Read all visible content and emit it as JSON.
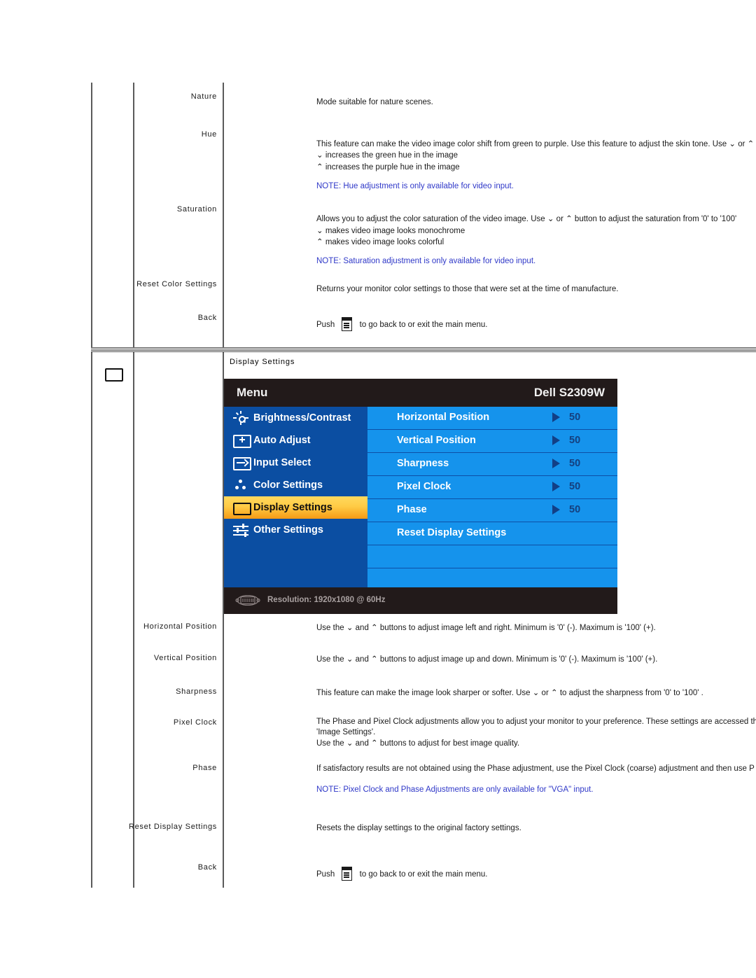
{
  "document": {
    "sections": [
      {
        "id": "color-settings-continued",
        "rows": [
          {
            "label": "Nature",
            "lines": [
              {
                "text": "Mode suitable for nature scenes."
              }
            ]
          },
          {
            "label": "Hue",
            "lines": [
              {
                "text": "This feature can make the video image color shift from green to purple. Use this feature to adjust the skin tone. Use ⌄ or ⌃"
              },
              {
                "text": "⌄ increases the green hue in the image"
              },
              {
                "text": "⌃ increases the purple hue in the image"
              },
              {
                "text": "NOTE: Hue adjustment is only available for video input.",
                "note": true
              }
            ]
          },
          {
            "label": "Saturation",
            "lines": [
              {
                "text": "Allows you to adjust the color saturation of the video image. Use ⌄ or ⌃ button to adjust the saturation from '0' to '100'"
              },
              {
                "text": "⌄ makes video image looks monochrome"
              },
              {
                "text": "⌃ makes video image looks colorful"
              },
              {
                "text": "NOTE: Saturation adjustment is only available for video input.",
                "note": true
              }
            ]
          },
          {
            "label": "Reset Color Settings",
            "lines": [
              {
                "text": "Returns your monitor color settings to those that were set at the time of manufacture."
              }
            ]
          },
          {
            "label": "Back",
            "lines": [
              {
                "text": "Push",
                "suffix": "to go back to or exit the main menu.",
                "button_icon": "menu-button-icon"
              }
            ]
          }
        ]
      },
      {
        "id": "display-settings",
        "icon": "rectangle-icon",
        "title": "Display Settings",
        "rows": [
          {
            "label": "Horizontal Position",
            "lines": [
              {
                "text": "Use the ⌄ and ⌃ buttons to adjust image left and right. Minimum is '0' (-). Maximum is '100' (+)."
              }
            ]
          },
          {
            "label": "Vertical Position",
            "lines": [
              {
                "text": "Use the ⌄ and ⌃ buttons to adjust image up and down. Minimum is '0' (-). Maximum is '100' (+)."
              }
            ]
          },
          {
            "label": "Sharpness",
            "lines": [
              {
                "text": "This feature can make the image look sharper or softer. Use ⌄ or ⌃ to adjust the sharpness from '0' to '100' ."
              }
            ]
          },
          {
            "label": "Pixel Clock",
            "lines": [
              {
                "text": "The Phase and Pixel Clock adjustments allow you to adjust your monitor to your preference. These settings are accessed th"
              },
              {
                "text": "'Image Settings'."
              },
              {
                "text": "Use the ⌄ and ⌃ buttons to adjust for best image quality."
              }
            ]
          },
          {
            "label": "Phase",
            "lines": [
              {
                "text": "If satisfactory results are not obtained using the Phase adjustment, use the Pixel Clock (coarse) adjustment and then use P"
              },
              {
                "text": "NOTE: Pixel Clock and Phase Adjustments are only available for \"VGA\" input.",
                "note": true
              }
            ]
          },
          {
            "label": "Reset Display Settings",
            "lines": [
              {
                "text": "Resets the display settings to the original factory settings."
              }
            ]
          },
          {
            "label": "Back",
            "lines": [
              {
                "text": "Push",
                "suffix": "to go back to or exit the main menu.",
                "button_icon": "menu-button-icon"
              }
            ]
          }
        ]
      }
    ]
  },
  "osd": {
    "title": "Menu",
    "model": "Dell S2309W",
    "left_menu": [
      {
        "label": "Brightness/Contrast",
        "icon": "brightness-icon",
        "selected": false
      },
      {
        "label": "Auto Adjust",
        "icon": "auto-adjust-icon",
        "selected": false
      },
      {
        "label": "Input Select",
        "icon": "input-select-icon",
        "selected": false
      },
      {
        "label": "Color Settings",
        "icon": "color-settings-icon",
        "selected": false
      },
      {
        "label": "Display Settings",
        "icon": "display-settings-icon",
        "selected": true
      },
      {
        "label": "Other Settings",
        "icon": "other-settings-icon",
        "selected": false
      }
    ],
    "right_items": [
      {
        "label": "Horizontal Position",
        "value": "50",
        "arrow": true
      },
      {
        "label": "Vertical Position",
        "value": "50",
        "arrow": true
      },
      {
        "label": "Sharpness",
        "value": "50",
        "arrow": true
      },
      {
        "label": "Pixel Clock",
        "value": "50",
        "arrow": true
      },
      {
        "label": "Phase",
        "value": "50",
        "arrow": true
      },
      {
        "label": "Reset Display Settings",
        "value": "",
        "arrow": false
      },
      {
        "label": "",
        "value": "",
        "arrow": false
      },
      {
        "label": "",
        "value": "",
        "arrow": false
      }
    ],
    "footer": {
      "resolution": "Resolution: 1920x1080 @ 60Hz",
      "icon": "vga-connector-icon"
    },
    "colors": {
      "title_bar": "#221a1a",
      "left_panel": "#0b4ea2",
      "right_panel": "#1593ec",
      "selected_gradient_start": "#ffd95e",
      "selected_gradient_end": "#f59a15",
      "value_text": "#15407f",
      "footer_text": "#a9a1a1"
    }
  }
}
